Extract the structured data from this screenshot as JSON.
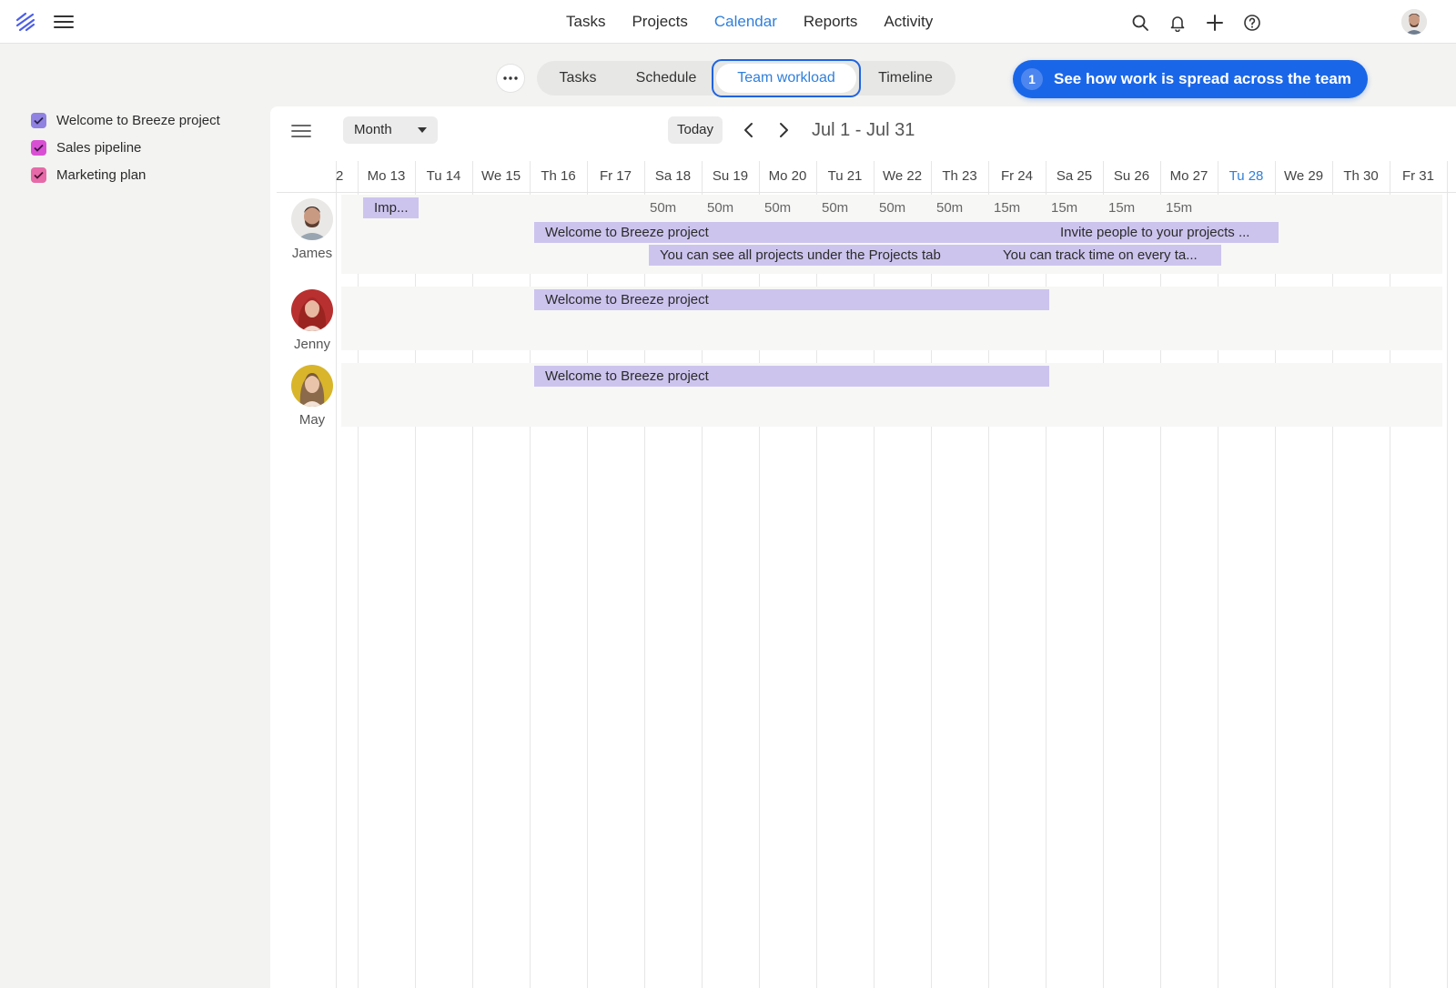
{
  "nav": {
    "items": [
      "Tasks",
      "Projects",
      "Calendar",
      "Reports",
      "Activity"
    ],
    "active": "Calendar"
  },
  "top_icons": [
    "search-icon",
    "bell-icon",
    "plus-icon",
    "help-icon"
  ],
  "view_tabs": {
    "tasks": "Tasks",
    "schedule": "Schedule",
    "team_workload": "Team workload",
    "timeline": "Timeline"
  },
  "tip": {
    "number": "1",
    "text": "See how work is spread across the team"
  },
  "legend": [
    {
      "label": "Welcome to Breeze project",
      "color": "#8f82e0"
    },
    {
      "label": "Sales pipeline",
      "color": "#d94fd4"
    },
    {
      "label": "Marketing plan",
      "color": "#e66aa8"
    }
  ],
  "toolbar": {
    "view_select": "Month",
    "today": "Today",
    "range": "Jul 1 - Jul 31"
  },
  "days": [
    "2",
    "Mo 13",
    "Tu 14",
    "We 15",
    "Th 16",
    "Fr 17",
    "Sa 18",
    "Su 19",
    "Mo 20",
    "Tu 21",
    "We 22",
    "Th 23",
    "Fr 24",
    "Sa 25",
    "Su 26",
    "Mo 27",
    "Tu 28",
    "We 29",
    "Th 30",
    "Fr 31"
  ],
  "today_label": "Tu 28",
  "people": [
    {
      "name": "James",
      "durations": [
        "50m",
        "50m",
        "50m",
        "50m",
        "50m",
        "50m",
        "15m",
        "15m",
        "15m",
        "15m"
      ],
      "bars": [
        "Imp...",
        "Welcome to Breeze project",
        "Invite people to your projects ...",
        "You can see all projects under the Projects tab",
        "You can track time on every ta..."
      ]
    },
    {
      "name": "Jenny",
      "bars": [
        "Welcome to Breeze project"
      ]
    },
    {
      "name": "May",
      "bars": [
        "Welcome to Breeze project"
      ]
    }
  ],
  "colors": {
    "accent": "#1a66e8",
    "bar": "#cdc4ee",
    "active_tab_text": "#2f7fdb"
  }
}
